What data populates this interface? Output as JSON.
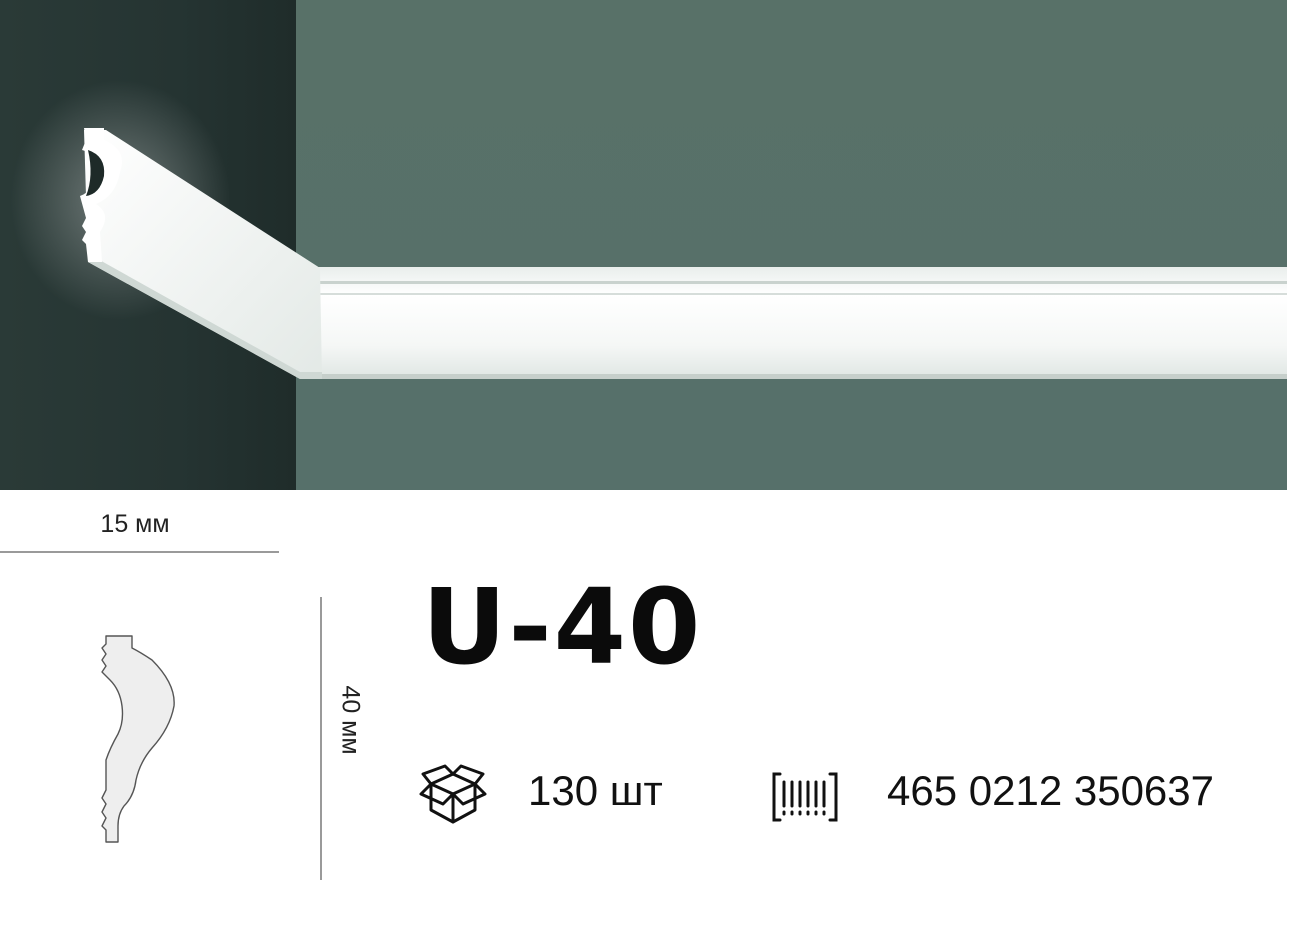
{
  "product": {
    "model": "U-40",
    "width_label": "15 мм",
    "height_label": "40 мм",
    "quantity_label": "130 шт",
    "barcode_label": "465 0212 350637"
  },
  "icons": {
    "package": "box-icon",
    "barcode": "barcode-icon",
    "profile": "molding-profile-icon"
  },
  "colors": {
    "wall": "#57706a",
    "wall_dark": "#233330",
    "molding": "#f4f6f5",
    "text": "#111111",
    "dimension_line": "#9a9a9a"
  }
}
